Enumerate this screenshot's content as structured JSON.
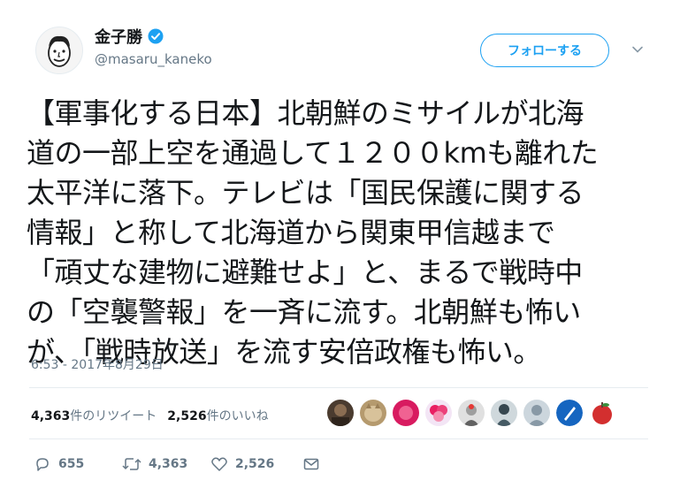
{
  "user": {
    "display_name": "金子勝",
    "handle": "@masaru_kaneko"
  },
  "follow_label": "フォローする",
  "tweet_lines": [
    "【軍事化する日本】北朝鮮のミサイルが北海",
    "道の一部上空を通過して１２００kmも離れた",
    "太平洋に落下。テレビは「国民保護に関する",
    "情報」と称して北海道から関東甲信越まで",
    "「頑丈な建物に避難せよ」と、まるで戦時中",
    "の「空襲警報」を一斉に流す。北朝鮮も怖い",
    "が、「戦時放送」を流す安倍政権も怖い。"
  ],
  "timestamp": "6:53 - 2017年8月29日",
  "stats": {
    "retweets_count": "4,363",
    "retweets_label": "件のリツイート",
    "likes_count": "2,526",
    "likes_label": "件のいいね"
  },
  "actions": {
    "replies": "655",
    "retweets": "4,363",
    "likes": "2,526"
  },
  "colors": {
    "accent": "#1da1f2",
    "secondary_text": "#657786",
    "divider": "#e6ecf0"
  },
  "icons": [
    "verified-badge-icon",
    "chevron-down-icon",
    "reply-icon",
    "retweet-icon",
    "like-icon",
    "message-icon"
  ]
}
